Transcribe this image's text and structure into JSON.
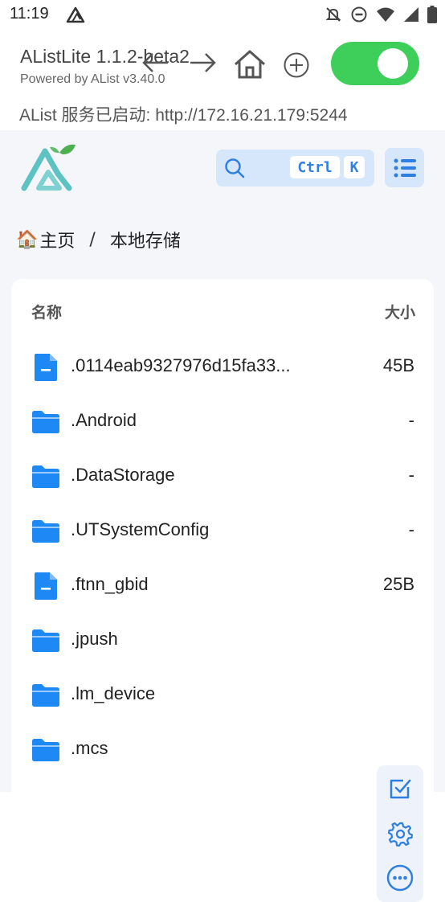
{
  "status_bar": {
    "time": "11:19",
    "icons": [
      "app-icon",
      "mute-icon",
      "dnd-icon",
      "wifi-icon",
      "signal-icon",
      "battery-icon"
    ]
  },
  "app": {
    "title": "AListLite 1.1.2-beta2",
    "subtitle": "Powered by AList v3.40.0",
    "server_status": "AList 服务已启动: http://172.16.21.179:5244",
    "toggle_on": true,
    "toggle_color": "#3ecf5a"
  },
  "search": {
    "kbd_ctrl": "Ctrl",
    "kbd_k": "K"
  },
  "breadcrumb": {
    "home_icon": "🏠",
    "home": "主页",
    "separator": "/",
    "current": "本地存储"
  },
  "list": {
    "col_name": "名称",
    "col_size": "大小",
    "rows": [
      {
        "type": "file",
        "name": ".0114eab9327976d15fa33...",
        "size": "45B"
      },
      {
        "type": "folder",
        "name": ".Android",
        "size": "-"
      },
      {
        "type": "folder",
        "name": ".DataStorage",
        "size": "-"
      },
      {
        "type": "folder",
        "name": ".UTSystemConfig",
        "size": "-"
      },
      {
        "type": "file",
        "name": ".ftnn_gbid",
        "size": "25B"
      },
      {
        "type": "folder",
        "name": ".jpush",
        "size": ""
      },
      {
        "type": "folder",
        "name": ".lm_device",
        "size": ""
      },
      {
        "type": "folder",
        "name": ".mcs",
        "size": ""
      }
    ]
  },
  "colors": {
    "accent": "#2f7fe0",
    "folder": "#1e88f5",
    "content_bg": "#f4f6fa"
  }
}
